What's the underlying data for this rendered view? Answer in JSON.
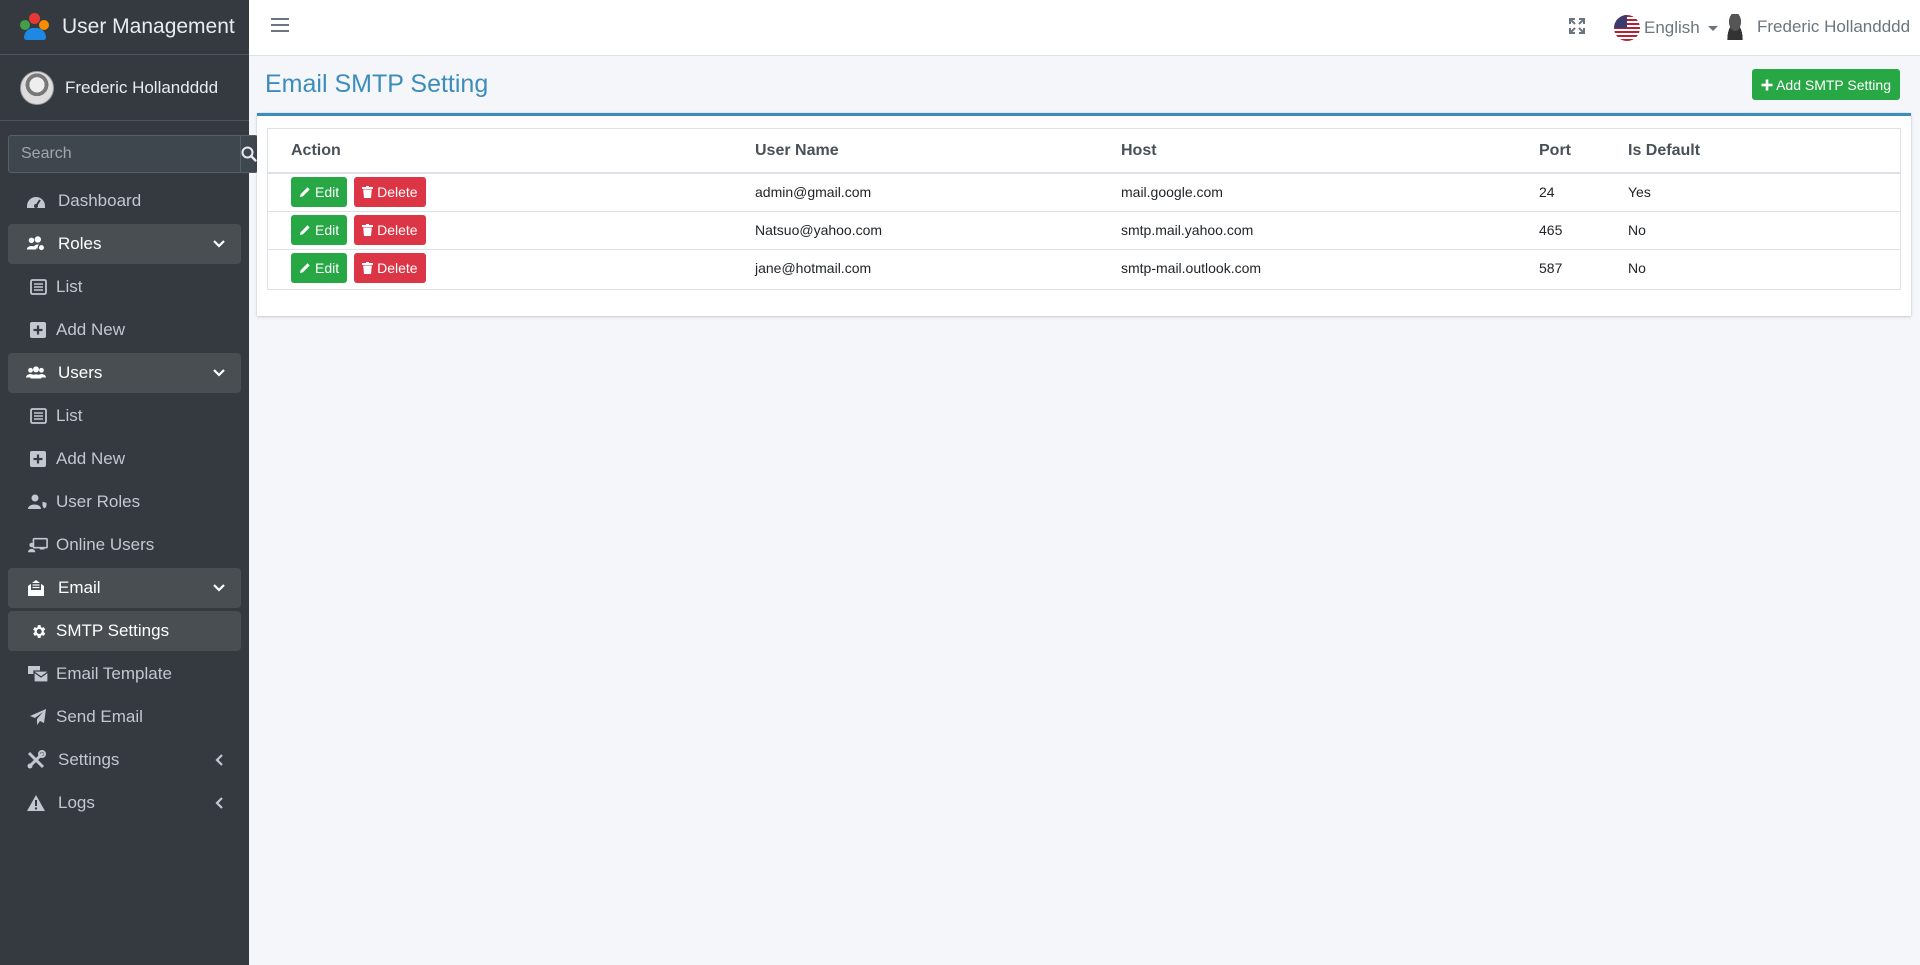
{
  "brand": {
    "title": "User Management"
  },
  "user": {
    "name": "Frederic Hollandddd"
  },
  "search": {
    "placeholder": "Search"
  },
  "sidebar": {
    "items": [
      {
        "label": "Dashboard",
        "icon": "tachometer-icon"
      },
      {
        "label": "Roles",
        "icon": "users-cog-icon"
      },
      {
        "label": "List",
        "icon": "list-icon"
      },
      {
        "label": "Add New",
        "icon": "plus-square-icon"
      },
      {
        "label": "Users",
        "icon": "users-icon"
      },
      {
        "label": "List",
        "icon": "list-icon"
      },
      {
        "label": "Add New",
        "icon": "plus-square-icon"
      },
      {
        "label": "User Roles",
        "icon": "user-shield-icon"
      },
      {
        "label": "Online Users",
        "icon": "chalkboard-user-icon"
      },
      {
        "label": "Email",
        "icon": "envelope-open-icon"
      },
      {
        "label": "SMTP Settings",
        "icon": "gear-icon"
      },
      {
        "label": "Email Template",
        "icon": "mail-bulk-icon"
      },
      {
        "label": "Send Email",
        "icon": "paper-plane-icon"
      },
      {
        "label": "Settings",
        "icon": "tools-icon"
      },
      {
        "label": "Logs",
        "icon": "warning-icon"
      }
    ]
  },
  "topbar": {
    "language": "English",
    "user_name": "Frederic Hollandddd"
  },
  "page": {
    "title": "Email SMTP Setting",
    "add_button": "Add SMTP Setting"
  },
  "table": {
    "headers": [
      "Action",
      "User Name",
      "Host",
      "Port",
      "Is Default"
    ],
    "edit_label": "Edit",
    "delete_label": "Delete",
    "rows": [
      {
        "user_name": "admin@gmail.com",
        "host": "mail.google.com",
        "port": "24",
        "is_default": "Yes"
      },
      {
        "user_name": "Natsuo@yahoo.com",
        "host": "smtp.mail.yahoo.com",
        "port": "465",
        "is_default": "No"
      },
      {
        "user_name": "jane@hotmail.com",
        "host": "smtp-mail.outlook.com",
        "port": "587",
        "is_default": "No"
      }
    ]
  },
  "colors": {
    "sidebar_bg": "#343a40",
    "accent": "#3c8dbc",
    "success": "#28a745",
    "danger": "#dc3545"
  }
}
